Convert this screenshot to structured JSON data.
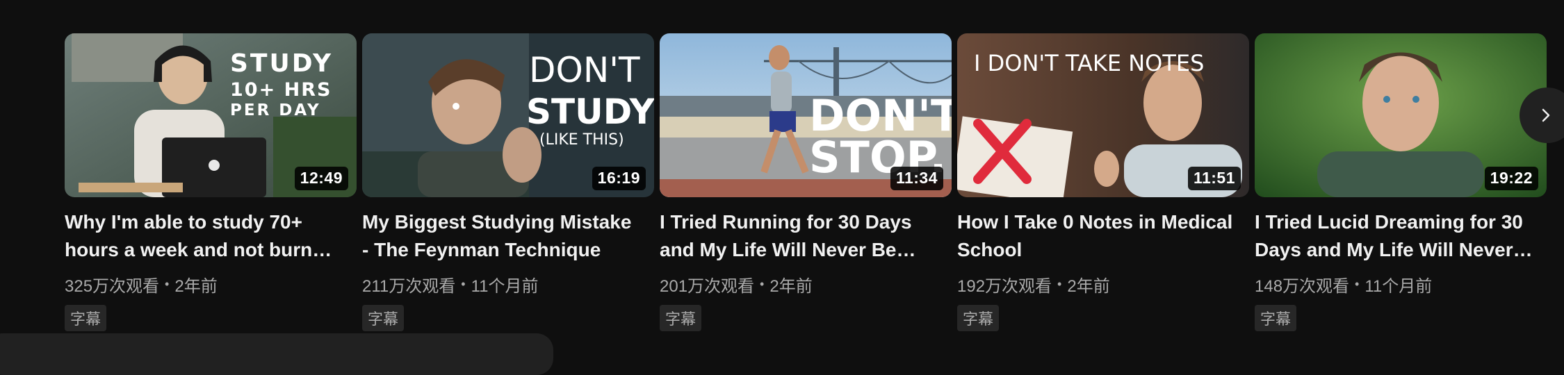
{
  "videos": [
    {
      "thumb_text": [
        "STUDY",
        "10+ HRS",
        "PER DAY"
      ],
      "duration": "12:49",
      "title": "Why I'm able to study 70+ hours a week and not burn…",
      "views": "325万次观看",
      "age": "2年前",
      "badge": "字幕"
    },
    {
      "thumb_text": [
        "DON'T",
        "STUDY",
        "(LIKE THIS)"
      ],
      "duration": "16:19",
      "title": "My Biggest Studying Mistake - The Feynman Technique",
      "views": "211万次观看",
      "age": "11个月前",
      "badge": "字幕"
    },
    {
      "thumb_text": [
        "DON'T",
        "STOP."
      ],
      "duration": "11:34",
      "title": "I Tried Running for 30 Days and My Life Will Never Be…",
      "views": "201万次观看",
      "age": "2年前",
      "badge": "字幕"
    },
    {
      "thumb_text": [
        "I DON'T TAKE NOTES"
      ],
      "duration": "11:51",
      "title": "How I Take 0 Notes in Medical School",
      "views": "192万次观看",
      "age": "2年前",
      "badge": "字幕"
    },
    {
      "thumb_text": [],
      "duration": "19:22",
      "title": "I Tried Lucid Dreaming for 30 Days and My Life Will Never…",
      "views": "148万次观看",
      "age": "11个月前",
      "badge": "字幕"
    }
  ],
  "separator": "•",
  "icons": {
    "next": "chevron-right-icon"
  }
}
